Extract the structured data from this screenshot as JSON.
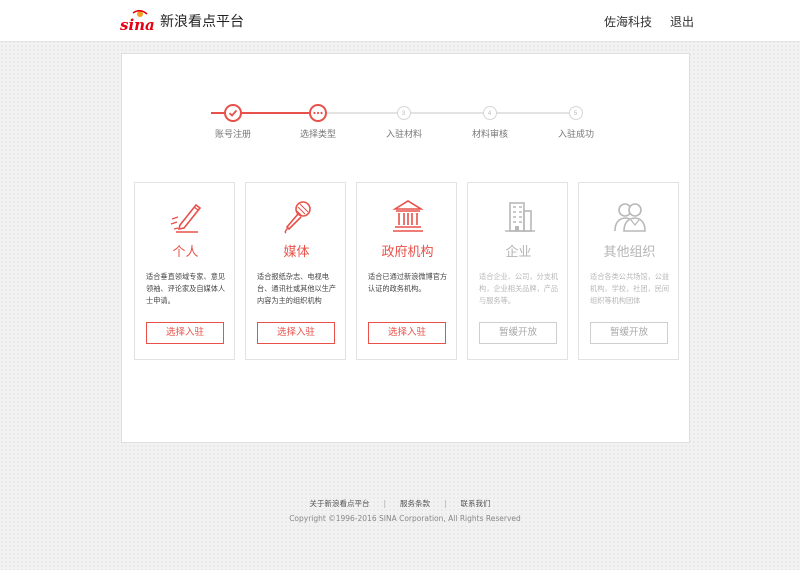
{
  "header": {
    "logo_text": "sina",
    "title": "新浪看点平台",
    "company": "佐海科技",
    "logout_label": "退出"
  },
  "steps": [
    {
      "label": "账号注册",
      "state": "done"
    },
    {
      "label": "选择类型",
      "state": "current"
    },
    {
      "label": "入驻材料",
      "state": "pending"
    },
    {
      "label": "材料审核",
      "state": "pending"
    },
    {
      "label": "入驻成功",
      "state": "pending"
    }
  ],
  "cards": [
    {
      "title": "个人",
      "desc": "适合垂直领域专家、意见领袖、评论家及自媒体人士申请。",
      "button": "选择入驻",
      "icon": "pen-icon",
      "active": true
    },
    {
      "title": "媒体",
      "desc": "适合报纸杂志、电视电台、通讯社或其他以生产内容为主的组织机构",
      "button": "选择入驻",
      "icon": "microphone-icon",
      "active": true
    },
    {
      "title": "政府机构",
      "desc": "适合已通过新浪微博官方认证的政务机构。",
      "button": "选择入驻",
      "icon": "government-building-icon",
      "active": true
    },
    {
      "title": "企业",
      "desc": "适合企业、公司，分支机构，企业相关品牌，产品与服务等。",
      "button": "暂缓开放",
      "icon": "office-building-icon",
      "active": false
    },
    {
      "title": "其他组织",
      "desc": "适合各类公共场馆，公益机构，学校，社团，民间组织等机构团体",
      "button": "暂缓开放",
      "icon": "people-icon",
      "active": false
    }
  ],
  "footer": {
    "links": [
      "关于新浪看点平台",
      "服务条款",
      "联系我们"
    ],
    "copyright": "Copyright ©1996-2016 SINA Corporation, All Rights Reserved"
  },
  "colors": {
    "accent": "#e8514a",
    "disabled": "#c8c8c8",
    "brand_red": "#e60012"
  }
}
